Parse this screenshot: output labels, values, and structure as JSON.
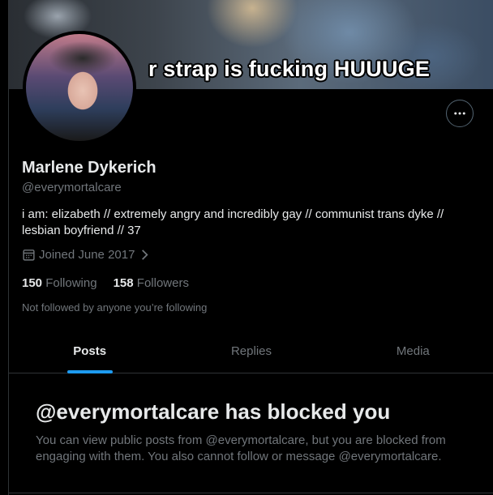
{
  "banner": {
    "caption": "r strap is fucking HUUUGE"
  },
  "profile": {
    "name": "Marlene Dykerich",
    "handle": "@everymortalcare",
    "bio": "i am: elizabeth // extremely angry and incredibly gay // communist trans dyke // lesbian boyfriend // 37",
    "joined": "Joined June 2017",
    "following_count": "150",
    "following_label": "Following",
    "followers_count": "158",
    "followers_label": "Followers",
    "followed_by": "Not followed by anyone you’re following"
  },
  "tabs": [
    {
      "label": "Posts",
      "active": true
    },
    {
      "label": "Replies",
      "active": false
    },
    {
      "label": "Media",
      "active": false
    }
  ],
  "blocked": {
    "title": "@everymortalcare has blocked you",
    "description": "You can view public posts from @everymortalcare, but you are blocked from engaging with them. You also cannot follow or message @everymortalcare."
  },
  "colors": {
    "background": "#000000",
    "text": "#e7e9ea",
    "muted": "#71767b",
    "accent": "#1d9bf0",
    "border": "#2f3336"
  }
}
